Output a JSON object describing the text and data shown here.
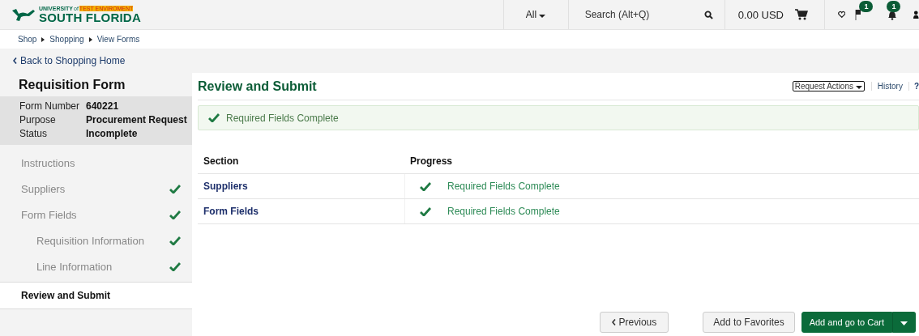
{
  "header": {
    "logo": {
      "top": "UNIVERSITY",
      "of": "of",
      "env": "TEST ENVIROMENT",
      "name": "SOUTH FLORIDA"
    },
    "scope": "All",
    "search": {
      "placeholder": "Search (Alt+Q)"
    },
    "cart_total": "0.00 USD",
    "flag_badge": "1",
    "bell_badge": "1"
  },
  "breadcrumb": [
    "Shop",
    "Shopping",
    "View Forms"
  ],
  "back_link": "Back to Shopping Home",
  "sidebar": {
    "title": "Requisition Form",
    "info": [
      {
        "label": "Form Number",
        "value": "640221"
      },
      {
        "label": "Purpose",
        "value": "Procurement Request"
      },
      {
        "label": "Status",
        "value": "Incomplete"
      }
    ],
    "items": [
      {
        "label": "Instructions",
        "complete": false,
        "selected": false
      },
      {
        "label": "Suppliers",
        "complete": true,
        "selected": false
      },
      {
        "label": "Form Fields",
        "complete": true,
        "selected": false,
        "children": [
          {
            "label": "Requisition Information",
            "complete": true,
            "selected": false
          },
          {
            "label": "Line Information",
            "complete": true,
            "selected": false
          }
        ]
      },
      {
        "label": "Review and Submit",
        "complete": false,
        "selected": true
      }
    ]
  },
  "main": {
    "title": "Review and Submit",
    "actions": [
      "Request Actions",
      "History",
      "?"
    ],
    "alert": "Required Fields Complete",
    "table": {
      "columns": [
        "Section",
        "Progress"
      ],
      "rows": [
        {
          "section": "Suppliers",
          "complete": true,
          "progress": "Required Fields Complete"
        },
        {
          "section": "Form Fields",
          "complete": true,
          "progress": "Required Fields Complete"
        }
      ]
    },
    "buttons": {
      "previous": "Previous",
      "favorites": "Add to Favorites",
      "cart": "Add and go to Cart"
    }
  }
}
